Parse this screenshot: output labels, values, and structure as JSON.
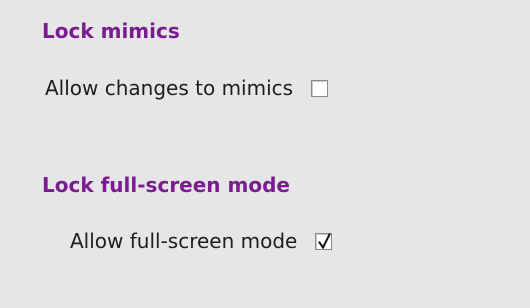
{
  "sections": [
    {
      "heading": "Lock mimics",
      "option": {
        "label": "Allow changes to mimics",
        "checked": false
      }
    },
    {
      "heading": "Lock full-screen mode",
      "option": {
        "label": "Allow full-screen mode",
        "checked": true
      }
    }
  ],
  "colors": {
    "heading": "#7a1c8f",
    "background": "#e6e6e6",
    "text": "#1e1e1e"
  },
  "icons": [
    "checkmark-icon"
  ]
}
